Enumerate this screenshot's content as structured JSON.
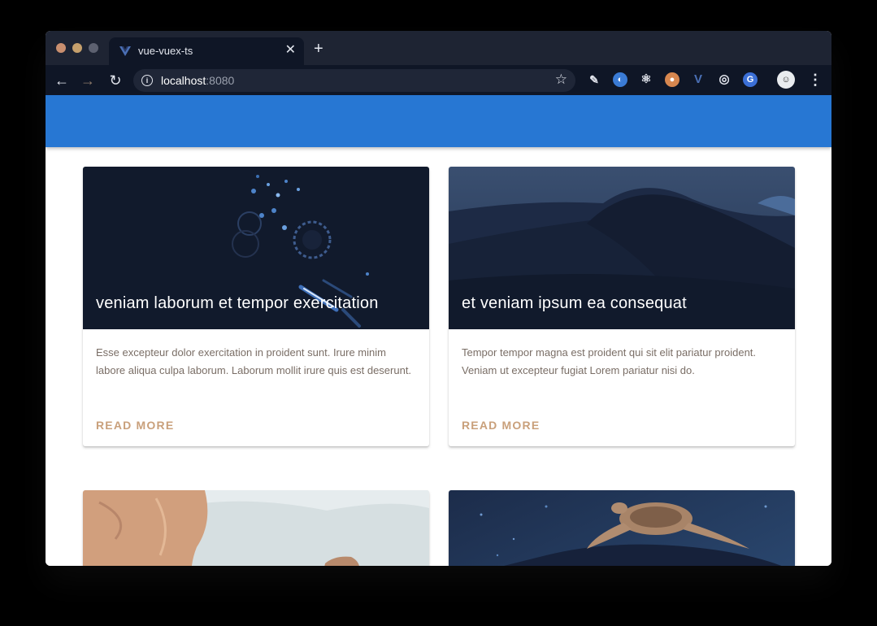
{
  "browser": {
    "tab_title": "vue-vuex-ts",
    "url_host": "localhost",
    "url_port": ":8080"
  },
  "cards": [
    {
      "title": "veniam laborum et tempor exercitation",
      "text": "Esse excepteur dolor exercitation in proident sunt. Irure minim labore aliqua culpa laborum. Laborum mollit irure quis est deserunt.",
      "action": "READ MORE"
    },
    {
      "title": "et veniam ipsum ea consequat",
      "text": "Tempor tempor magna est proident qui sit elit pariatur proident. Veniam ut excepteur fugiat Lorem pariatur nisi do.",
      "action": "READ MORE"
    },
    {
      "title": "",
      "text": "",
      "action": ""
    },
    {
      "title": "",
      "text": "",
      "action": ""
    }
  ],
  "colors": {
    "app_bar": "#2777d3",
    "action_text": "#c9a07b",
    "tab_strip": "#1e2433",
    "toolbar": "#0f1626"
  }
}
